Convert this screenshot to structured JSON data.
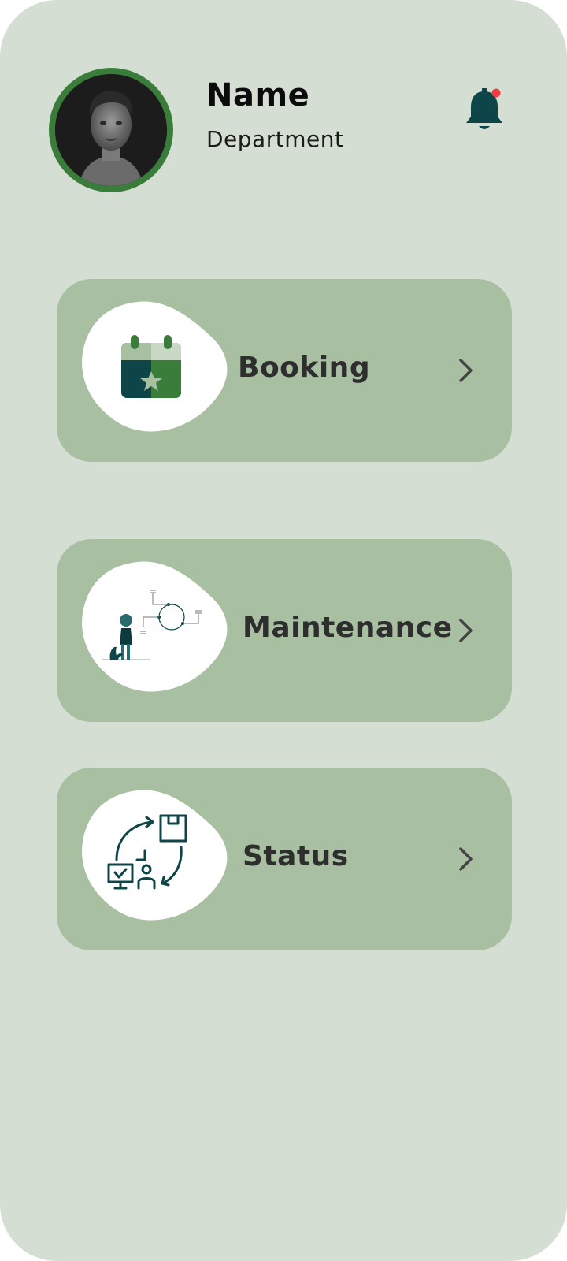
{
  "profile": {
    "name": "Name",
    "department": "Department",
    "avatar_icon": "user-photo",
    "ring_color": "#3a7d3a"
  },
  "notifications": {
    "icon": "bell-icon",
    "badge_color": "#f03c3c",
    "has_unread": true
  },
  "menu": {
    "items": [
      {
        "label": "Booking",
        "icon": "calendar-star-icon"
      },
      {
        "label": "Maintenance",
        "icon": "maintenance-illustration-icon"
      },
      {
        "label": "Status",
        "icon": "status-flow-icon"
      }
    ]
  },
  "colors": {
    "background": "#d4ded2",
    "card": "#a8bfa2",
    "accent_dark": "#0d4548",
    "accent_green": "#3a7d3a",
    "text": "#2e2e2e"
  }
}
